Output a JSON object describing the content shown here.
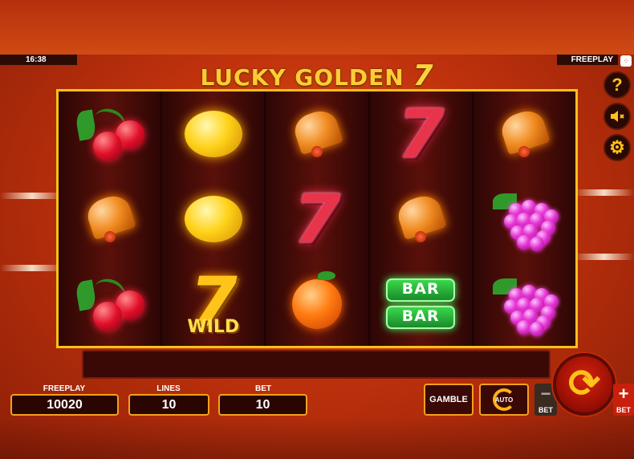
{
  "header": {
    "clock": "16:38",
    "mode_tag": "FREEPLAY",
    "title_main": "LUCKY GOLDEN",
    "title_seven": "7"
  },
  "side_buttons": {
    "help_icon": "question-icon",
    "sound_icon": "speaker-muted-icon",
    "settings_icon": "gear-icon"
  },
  "reels": [
    [
      "cherry",
      "bell",
      "cherry"
    ],
    [
      "lemon",
      "lemon",
      "wild-seven"
    ],
    [
      "bell",
      "seven",
      "orange"
    ],
    [
      "seven",
      "bell",
      "bar-bar"
    ],
    [
      "bell",
      "grapes",
      "grapes"
    ]
  ],
  "symbols_text": {
    "seven": "7",
    "wild_label": "WILD",
    "bar_label": "BAR"
  },
  "stats": {
    "freeplay_label": "FREEPLAY",
    "freeplay_value": "10020",
    "lines_label": "LINES",
    "lines_value": "10",
    "bet_label": "BET",
    "bet_value": "10"
  },
  "controls": {
    "gamble_label": "GAMBLE",
    "auto_label": "AUTO",
    "bet_minus_sign": "−",
    "bet_plus_sign": "+",
    "bet_minus_label": "BET",
    "bet_plus_label": "BET",
    "spin_icon": "spin-arrows-icon"
  },
  "colors": {
    "frame_gold": "#f5c21a",
    "background": "#c0320c",
    "button_border": "#f5a01a"
  }
}
